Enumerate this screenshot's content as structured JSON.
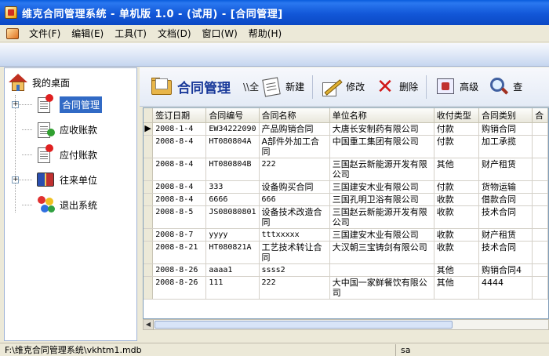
{
  "window": {
    "title": "维克合同管理系统 - 单机版 1.0 - (试用) - [合同管理]"
  },
  "menu": {
    "items": [
      "文件(F)",
      "编辑(E)",
      "工具(T)",
      "文档(D)",
      "窗口(W)",
      "帮助(H)"
    ]
  },
  "sidebar": {
    "root_label": "我的桌面",
    "items": [
      {
        "label": "合同管理",
        "selected": true,
        "expandable": true,
        "icon": "contract-icon"
      },
      {
        "label": "应收账款",
        "selected": false,
        "expandable": false,
        "icon": "receivable-icon"
      },
      {
        "label": "应付账款",
        "selected": false,
        "expandable": false,
        "icon": "payable-icon"
      },
      {
        "label": "往来单位",
        "selected": false,
        "expandable": true,
        "icon": "contacts-book-icon"
      },
      {
        "label": "退出系统",
        "selected": false,
        "expandable": false,
        "icon": "exit-icon"
      }
    ]
  },
  "toolbar": {
    "title": "合同管理",
    "path": "\\\\全",
    "new_label": "新建",
    "edit_label": "修改",
    "delete_label": "删除",
    "advanced_label": "高级",
    "search_label": "查"
  },
  "table": {
    "columns": [
      "签订日期",
      "合同编号",
      "合同名称",
      "单位名称",
      "收付类型",
      "合同类别",
      "合"
    ],
    "rows": [
      [
        "2008-1-4",
        "EW34222090",
        "产品购销合同",
        "大唐长安制药有限公司",
        "付款",
        "购销合同",
        ""
      ],
      [
        "2008-8-4",
        "HT080804A",
        "A部件外加工合同",
        "中国重工集团有限公司",
        "付款",
        "加工承揽",
        ""
      ],
      [
        "2008-8-4",
        "HT080804B",
        "222",
        "三国赵云新能源开发有限公司",
        "其他",
        "财产租赁",
        ""
      ],
      [
        "2008-8-4",
        "333",
        "设备购买合同",
        "三国建安木业有限公司",
        "付款",
        "货物运输",
        ""
      ],
      [
        "2008-8-4",
        "6666",
        "666",
        "三国孔明卫浴有限公司",
        "收款",
        "借款合同",
        ""
      ],
      [
        "2008-8-5",
        "JS08080801",
        "设备技术改造合同",
        "三国赵云新能源开发有限公司",
        "收款",
        "技术合同",
        ""
      ],
      [
        "2008-8-7",
        "yyyy",
        "tttxxxxx",
        "三国建安木业有限公司",
        "收款",
        "财产租赁",
        ""
      ],
      [
        "2008-8-21",
        "HT080821A",
        "工艺技术转让合同",
        "大汉朝三宝铸剑有限公司",
        "收款",
        "技术合同",
        ""
      ],
      [
        "2008-8-26",
        "aaaa1",
        "ssss2",
        "",
        "其他",
        "购销合同4",
        ""
      ],
      [
        "2008-8-26",
        "111",
        "222",
        "大中国一家鲜餐饮有限公司",
        "其他",
        "4444",
        ""
      ]
    ],
    "current_row_indicator": "▶"
  },
  "status": {
    "path": "F:\\维克合同管理系统\\vkhtm1.mdb",
    "user": "sa"
  }
}
